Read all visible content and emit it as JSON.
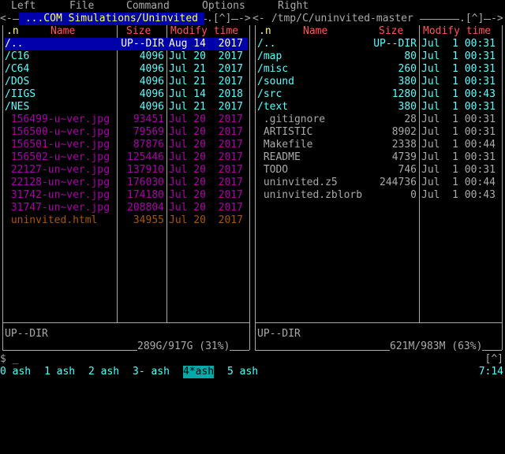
{
  "menu": [
    "Left",
    "File",
    "Command",
    "Options",
    "Right"
  ],
  "left_panel": {
    "path": " ...COM Simulations/Uninvited ",
    "nav": ".[^]",
    "headers": {
      "n": ".n",
      "name": "Name",
      "size": "Size",
      "time": "Modify time"
    },
    "rows": [
      {
        "name": "/..",
        "size": "UP--DIR",
        "date": "Aug 14  2017",
        "type": "sel"
      },
      {
        "name": "/C16",
        "size": "4096",
        "date": "Jul 20  2017",
        "type": "dir"
      },
      {
        "name": "/C64",
        "size": "4096",
        "date": "Jul 21  2017",
        "type": "dir"
      },
      {
        "name": "/DOS",
        "size": "4096",
        "date": "Jul 21  2017",
        "type": "dir"
      },
      {
        "name": "/IIGS",
        "size": "4096",
        "date": "Jul 14  2018",
        "type": "dir"
      },
      {
        "name": "/NES",
        "size": "4096",
        "date": "Jul 21  2017",
        "type": "dir"
      },
      {
        "name": " 156499-u~ver.jpg",
        "size": "93451",
        "date": "Jul 20  2017",
        "type": "img"
      },
      {
        "name": " 156500-u~ver.jpg",
        "size": "79569",
        "date": "Jul 20  2017",
        "type": "img"
      },
      {
        "name": " 156501-u~ver.jpg",
        "size": "87876",
        "date": "Jul 20  2017",
        "type": "img"
      },
      {
        "name": " 156502-u~ver.jpg",
        "size": "125446",
        "date": "Jul 20  2017",
        "type": "img"
      },
      {
        "name": " 22127-un~ver.jpg",
        "size": "137910",
        "date": "Jul 20  2017",
        "type": "img"
      },
      {
        "name": " 22128-un~ver.jpg",
        "size": "176030",
        "date": "Jul 20  2017",
        "type": "img"
      },
      {
        "name": " 31742-un~ver.jpg",
        "size": "174180",
        "date": "Jul 20  2017",
        "type": "img"
      },
      {
        "name": " 31747-un~ver.jpg",
        "size": "208804",
        "date": "Jul 20  2017",
        "type": "img"
      },
      {
        "name": " uninvited.html",
        "size": "34955",
        "date": "Jul 20  2017",
        "type": "htm"
      }
    ],
    "mini_status": "UP--DIR",
    "disk": "289G/917G (31%)"
  },
  "right_panel": {
    "path": " /tmp/C/uninvited-master ",
    "nav": ".[^]",
    "headers": {
      "n": ".n",
      "name": "Name",
      "size": "Size",
      "time": "Modify time"
    },
    "rows": [
      {
        "name": "/..",
        "size": "UP--DIR",
        "date": "Jul  1 00:31",
        "type": "dir"
      },
      {
        "name": "/map",
        "size": "80",
        "date": "Jul  1 00:31",
        "type": "dir"
      },
      {
        "name": "/misc",
        "size": "260",
        "date": "Jul  1 00:31",
        "type": "dir"
      },
      {
        "name": "/sound",
        "size": "380",
        "date": "Jul  1 00:31",
        "type": "dir"
      },
      {
        "name": "/src",
        "size": "1280",
        "date": "Jul  1 00:43",
        "type": "dir"
      },
      {
        "name": "/text",
        "size": "380",
        "date": "Jul  1 00:31",
        "type": "dir"
      },
      {
        "name": " .gitignore",
        "size": "28",
        "date": "Jul  1 00:31",
        "type": "norm"
      },
      {
        "name": " ARTISTIC",
        "size": "8902",
        "date": "Jul  1 00:31",
        "type": "norm"
      },
      {
        "name": " Makefile",
        "size": "2338",
        "date": "Jul  1 00:44",
        "type": "norm"
      },
      {
        "name": " README",
        "size": "4739",
        "date": "Jul  1 00:31",
        "type": "norm"
      },
      {
        "name": " TODO",
        "size": "746",
        "date": "Jul  1 00:31",
        "type": "norm"
      },
      {
        "name": " uninvited.z5",
        "size": "244736",
        "date": "Jul  1 00:44",
        "type": "norm"
      },
      {
        "name": " uninvited.zblorb",
        "size": "0",
        "date": "Jul  1 00:43",
        "type": "norm"
      }
    ],
    "mini_status": "UP--DIR",
    "disk": "621M/983M (63%)"
  },
  "prompt": "$ _",
  "corner": "[^]",
  "tabs": [
    "0 ash",
    "1 ash",
    "2 ash",
    "3- ash",
    "4*ash",
    "5 ash"
  ],
  "active_tab": 4,
  "clock": "7:14"
}
